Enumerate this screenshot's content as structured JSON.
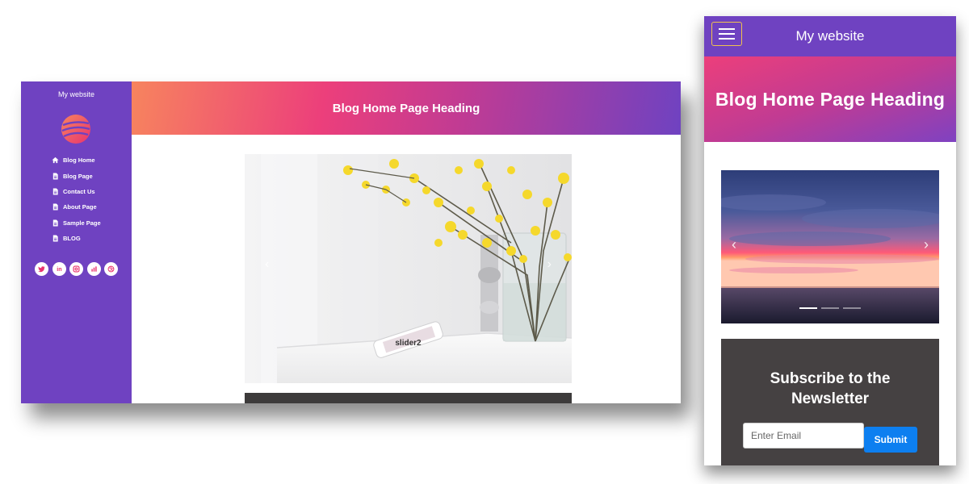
{
  "desktop": {
    "site_title": "My website",
    "heading": "Blog Home Page Heading",
    "nav": [
      {
        "label": "Blog Home",
        "icon": "home-icon"
      },
      {
        "label": "Blog Page",
        "icon": "file-icon"
      },
      {
        "label": "Contact Us",
        "icon": "file-icon"
      },
      {
        "label": "About Page",
        "icon": "file-icon"
      },
      {
        "label": "Sample Page",
        "icon": "file-icon"
      },
      {
        "label": "BLOG",
        "icon": "file-icon"
      }
    ],
    "social": [
      "twitter-icon",
      "linkedin-icon",
      "instagram-icon",
      "analytics-icon",
      "dribbble-icon"
    ],
    "slider": {
      "caption": "slider2",
      "prev_arrow": "‹",
      "next_arrow": "›"
    }
  },
  "mobile": {
    "site_title": "My website",
    "heading": "Blog Home Page Heading",
    "slider": {
      "prev_arrow": "‹",
      "next_arrow": "›",
      "indicators": 3,
      "active_indicator": 1
    },
    "newsletter": {
      "title": "Subscribe to the Newsletter",
      "email_placeholder": "Enter Email",
      "submit_label": "Submit"
    }
  },
  "colors": {
    "sidebar_purple": "#6f42c1",
    "gradient_orange": "#f7845e",
    "gradient_pink": "#ec3f7b",
    "newsletter_bg": "#454142",
    "submit_blue": "#0d7ff0",
    "hamburger_border": "#f0c24e"
  }
}
